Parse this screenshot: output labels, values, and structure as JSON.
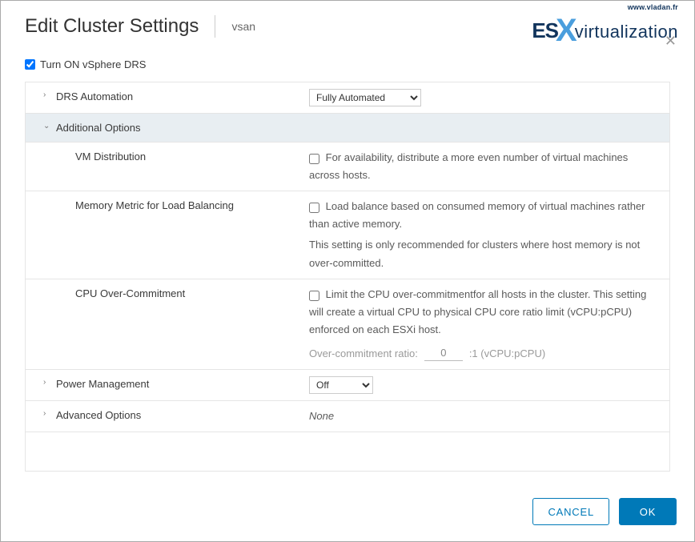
{
  "header": {
    "title": "Edit Cluster Settings",
    "subtitle": "vsan",
    "logo_url": "www.vladan.fr",
    "logo_es": "ES",
    "logo_x": "X",
    "logo_virt": "virtualization"
  },
  "turn_on": {
    "label": "Turn ON vSphere DRS",
    "checked": true
  },
  "rows": {
    "drs_automation": {
      "label": "DRS Automation",
      "select_value": "Fully Automated"
    },
    "additional_options": {
      "label": "Additional Options"
    },
    "vm_distribution": {
      "label": "VM Distribution",
      "desc": "For availability, distribute a more even number of virtual machines across hosts."
    },
    "memory_metric": {
      "label": "Memory Metric for Load Balancing",
      "desc": "Load balance based on consumed memory of virtual machines rather than active memory.",
      "desc2": "This setting is only recommended for clusters where host memory is not over-committed."
    },
    "cpu_over": {
      "label": "CPU Over-Commitment",
      "desc": "Limit the CPU over-commitmentfor all hosts in the cluster. This setting will create a virtual CPU to physical CPU core ratio limit (vCPU:pCPU) enforced on each ESXi host.",
      "ratio_label": "Over-commitment ratio:",
      "ratio_value": "0",
      "ratio_suffix": ":1 (vCPU:pCPU)"
    },
    "power_mgmt": {
      "label": "Power Management",
      "select_value": "Off"
    },
    "advanced": {
      "label": "Advanced Options",
      "value": "None"
    }
  },
  "footer": {
    "cancel": "CANCEL",
    "ok": "OK"
  }
}
